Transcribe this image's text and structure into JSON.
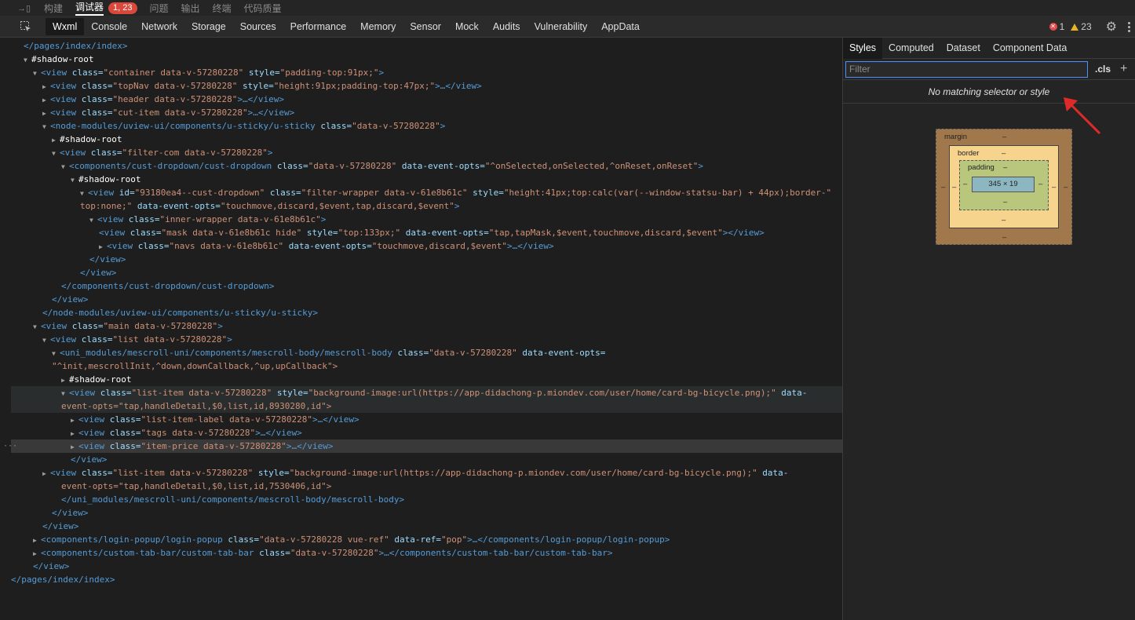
{
  "top_tabs": [
    {
      "label": "构建"
    },
    {
      "label": "调试器",
      "badge": "1, 23"
    },
    {
      "label": "问题"
    },
    {
      "label": "输出"
    },
    {
      "label": "终端"
    },
    {
      "label": "代码质量"
    }
  ],
  "devtools_tabs": [
    "Wxml",
    "Console",
    "Network",
    "Storage",
    "Sources",
    "Performance",
    "Memory",
    "Sensor",
    "Mock",
    "Audits",
    "Vulnerability",
    "AppData"
  ],
  "status": {
    "errors": "1",
    "warnings": "23"
  },
  "right_panel": {
    "tabs": [
      "Styles",
      "Computed",
      "Dataset",
      "Component Data"
    ],
    "filter_placeholder": "Filter",
    "cls_label": ".cls",
    "no_match": "No matching selector or style",
    "box_model": {
      "margin_label": "margin",
      "border_label": "border",
      "padding_label": "padding",
      "content_size": "345 × 19",
      "dash": "–"
    }
  },
  "tree_lines": [
    {
      "i": 0,
      "row": "</pages/index/index>"
    },
    {
      "i": 1,
      "row": "#shadow-root"
    },
    {
      "t": "view",
      "a": [
        [
          "class",
          "container data-v-57280228"
        ],
        [
          "style",
          "padding-top:91px;"
        ]
      ]
    },
    {
      "t": "view",
      "a": [
        [
          "class",
          "topNav data-v-57280228"
        ],
        [
          "style",
          "height:91px;padding-top:47px;"
        ]
      ]
    },
    {
      "t": "view",
      "a": [
        [
          "class",
          "header data-v-57280228"
        ]
      ]
    },
    {
      "t": "view",
      "a": [
        [
          "class",
          "cut-item data-v-57280228"
        ]
      ]
    },
    {
      "t": "node-modules/uview-ui/components/u-sticky/u-sticky",
      "a": [
        [
          "class",
          "data-v-57280228"
        ]
      ]
    },
    {
      "row": "#shadow-root"
    },
    {
      "t": "view",
      "a": [
        [
          "class",
          "filter-com data-v-57280228"
        ]
      ]
    },
    {
      "t": "components/cust-dropdown/cust-dropdown",
      "a": [
        [
          "class",
          "data-v-57280228"
        ],
        [
          "data-event-opts",
          "^onSelected,onSelected,^onReset,onReset"
        ]
      ]
    },
    {
      "row": "#shadow-root"
    },
    {
      "t": "view",
      "a": [
        [
          "id",
          "93180ea4--cust-dropdown"
        ],
        [
          "class",
          "filter-wrapper data-v-61e8b61c"
        ],
        [
          "style",
          "height:41px;top:calc(var(--window-statsu-bar) + 44px);border-"
        ]
      ]
    },
    {
      "cont": "top:none;\"",
      "a2": [
        [
          "data-event-opts",
          "touchmove,discard,$event,tap,discard,$event"
        ]
      ]
    },
    {
      "t": "view",
      "a": [
        [
          "class",
          "inner-wrapper data-v-61e8b61c"
        ]
      ]
    },
    {
      "t": "view",
      "a": [
        [
          "class",
          "mask data-v-61e8b61c hide"
        ],
        [
          "style",
          "top:133px;"
        ],
        [
          "data-event-opts",
          "tap,tapMask,$event,touchmove,discard,$event"
        ]
      ]
    },
    {
      "t": "view",
      "a": [
        [
          "class",
          "navs data-v-61e8b61c"
        ],
        [
          "data-event-opts",
          "touchmove,discard,$event"
        ]
      ]
    },
    {
      "close": "view"
    },
    {
      "close": "view"
    },
    {
      "close": "components/cust-dropdown/cust-dropdown"
    },
    {
      "close": "view"
    },
    {
      "close": "node-modules/uview-ui/components/u-sticky/u-sticky"
    },
    {
      "t": "view",
      "a": [
        [
          "class",
          "main data-v-57280228"
        ]
      ]
    },
    {
      "t": "view",
      "a": [
        [
          "class",
          "list data-v-57280228"
        ]
      ]
    },
    {
      "t": "uni_modules/mescroll-uni/components/mescroll-body/mescroll-body",
      "a": [
        [
          "class",
          "data-v-57280228"
        ]
      ],
      "tail": "data-event-opts="
    },
    {
      "cont": "\"^init,mescrollInit,^down,downCallback,^up,upCallback\">"
    },
    {
      "row": "#shadow-root"
    },
    {
      "t": "view",
      "a": [
        [
          "class",
          "list-item data-v-57280228"
        ],
        [
          "style",
          "background-image:url(https://app-didachong-p.miondev.com/user/home/card-bg-bicycle.png);"
        ]
      ],
      "tail": "data-"
    },
    {
      "cont": "event-opts=\"tap,handleDetail,$0,list,id,8930280,id\">"
    },
    {
      "t": "view",
      "a": [
        [
          "class",
          "list-item-label data-v-57280228"
        ]
      ]
    },
    {
      "t": "view",
      "a": [
        [
          "class",
          "tags data-v-57280228"
        ]
      ]
    },
    {
      "t": "view",
      "a": [
        [
          "class",
          "item-price data-v-57280228"
        ]
      ]
    },
    {
      "close": "view"
    },
    {
      "t": "view",
      "a": [
        [
          "class",
          "list-item data-v-57280228"
        ],
        [
          "style",
          "background-image:url(https://app-didachong-p.miondev.com/user/home/card-bg-bicycle.png);"
        ]
      ],
      "tail": "data-"
    },
    {
      "cont": "event-opts=\"tap,handleDetail,$0,list,id,7530406,id\">"
    },
    {
      "close": "uni_modules/mescroll-uni/components/mescroll-body/mescroll-body"
    },
    {
      "close": "view"
    },
    {
      "close": "view"
    },
    {
      "t": "components/login-popup/login-popup",
      "a": [
        [
          "class",
          "data-v-57280228 vue-ref"
        ],
        [
          "data-ref",
          "pop"
        ]
      ]
    },
    {
      "t": "components/custom-tab-bar/custom-tab-bar",
      "a": [
        [
          "class",
          "data-v-57280228"
        ]
      ]
    },
    {
      "close": "view"
    },
    {
      "close": "pages/index/index"
    }
  ]
}
